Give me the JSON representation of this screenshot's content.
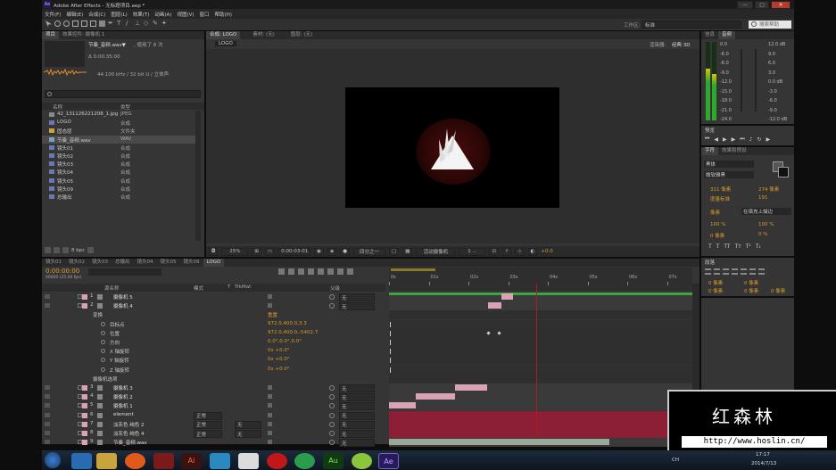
{
  "app": {
    "title": "Adobe After Effects - 无标题项目.aep *"
  },
  "menu": [
    "文件(F)",
    "编辑(E)",
    "合成(C)",
    "图层(L)",
    "效果(T)",
    "动画(A)",
    "视图(V)",
    "窗口",
    "帮助(H)"
  ],
  "toolbar": {
    "workspace_label": "工作区:",
    "workspace_value": "标准",
    "search_placeholder": "搜索帮助"
  },
  "project": {
    "tab_project": "项目",
    "tab_effects": "效果控件: 摄像机 1",
    "selected_name": "节奏_音频.wav▼",
    "used_times": ", 使用了 8 次",
    "duration": "Δ 0:00:35:00",
    "audio_info": "44.100 kHz / 32 bit U / 立体声",
    "col_name": "名称",
    "col_type": "类型",
    "items": [
      {
        "name": "42_131126221208_1.jpg",
        "type": "JPEG"
      },
      {
        "name": "LOGO",
        "type": "合成"
      },
      {
        "name": "固态层",
        "type": "文件夹"
      },
      {
        "name": "节奏_音频.wav",
        "type": "WAV"
      },
      {
        "name": "镜头01",
        "type": "合成"
      },
      {
        "name": "镜头02",
        "type": "合成"
      },
      {
        "name": "镜头03",
        "type": "合成"
      },
      {
        "name": "镜头04",
        "type": "合成"
      },
      {
        "name": "镜头05",
        "type": "合成"
      },
      {
        "name": "镜头09",
        "type": "合成"
      },
      {
        "name": "总输出",
        "type": "合成"
      }
    ],
    "bpc": "8 bpc"
  },
  "viewer": {
    "tab_comp": "合成: LOGO",
    "tab_footage": "素材: (无)",
    "tab_layer": "图层: (无)",
    "comp_chip": "LOGO",
    "renderer_label": "渲染器:",
    "renderer_value": "经典 3D",
    "zoom": "25%",
    "timecode": "0:00:03:01",
    "resolution": "四分之一",
    "view": "活动摄像机",
    "views": "1 ...",
    "exposure": "+0.0"
  },
  "audio": {
    "tab_info": "信息",
    "tab_audio": "音频",
    "left_scale": [
      "0.0",
      "-6.0",
      "-6.0",
      "-9.0",
      "-12.0",
      "-15.0",
      "-18.0",
      "-21.0",
      "-24.0"
    ],
    "right_scale": [
      "12.0 dB",
      "9.0",
      "6.0",
      "3.0",
      "0.0 dB",
      "-3.0",
      "-6.0",
      "-9.0",
      "-12.0 dB"
    ]
  },
  "preview": {
    "title": "预览"
  },
  "character": {
    "tab_char": "字符",
    "tab_effects": "效果和预设",
    "font": "黑体",
    "style": "微软雅黑",
    "size": "311 像素",
    "leading": "274 像素",
    "kerning": "度量标准",
    "tracking": "191",
    "stroke_w": "像素",
    "stroke_type": "在填充上描边",
    "v_scale": "100 %",
    "h_scale": "100 %",
    "baseline": "0 像素",
    "tsume": "0 %"
  },
  "paragraph": {
    "title": "段落",
    "indents": [
      "0 像素",
      "0 像素",
      "0 像素",
      "0 像素",
      "0 像素"
    ]
  },
  "timeline": {
    "tabs": [
      "镜头01",
      "镜头02",
      "镜头03",
      "总输出",
      "镜头04",
      "镜头05",
      "镜头09",
      "LOGO"
    ],
    "timecode": "0:00:00:00",
    "fps": "00000 (25.00 fps)",
    "col_name": "源名称",
    "col_mode": "模式",
    "col_t": "T",
    "col_trkmat": "TrkMat",
    "col_parent": "父级",
    "ruler": [
      "0s",
      "01s",
      "02s",
      "03s",
      "04s",
      "05s",
      "06s",
      "07s"
    ],
    "layers_top": [
      {
        "num": "1",
        "name": "摄像机 5",
        "parent": "无"
      },
      {
        "num": "2",
        "name": "摄像机 4",
        "parent": "无"
      }
    ],
    "transform": {
      "label": "变换",
      "reset": "重置",
      "props": [
        {
          "name": "目标点",
          "value": "972.0,400.0,3.3"
        },
        {
          "name": "位置",
          "value": "972.0,400.0,-5402.7"
        },
        {
          "name": "方向",
          "value": "0.0°,0.0°,0.0°"
        },
        {
          "name": "X 轴旋转",
          "value": "0x +0.0°"
        },
        {
          "name": "Y 轴旋转",
          "value": "0x +0.0°"
        },
        {
          "name": "Z 轴旋转",
          "value": "0x +0.0°"
        }
      ],
      "camera_options": "摄像机选项"
    },
    "layers_bottom": [
      {
        "num": "3",
        "name": "摄像机 3",
        "mode": "",
        "trk": "",
        "parent": "无"
      },
      {
        "num": "4",
        "name": "摄像机 2",
        "mode": "",
        "trk": "",
        "parent": "无"
      },
      {
        "num": "5",
        "name": "摄像机 1",
        "mode": "",
        "trk": "",
        "parent": "无"
      },
      {
        "num": "6",
        "name": "element",
        "mode": "正常",
        "trk": "",
        "parent": "无"
      },
      {
        "num": "7",
        "name": "淡灰色 纯色 2",
        "mode": "正常",
        "trk": "无",
        "parent": "无"
      },
      {
        "num": "8",
        "name": "淡灰色 纯色 4",
        "mode": "正常",
        "trk": "无",
        "parent": "无"
      },
      {
        "num": "9",
        "name": "节奏_音频.wav",
        "mode": "",
        "trk": "",
        "parent": "无"
      }
    ]
  },
  "watermark": {
    "title": "红森林",
    "url": "http://www.hoslin.cn/"
  },
  "taskbar": {
    "time": "17:17",
    "date": "2014/7/13",
    "lang": "CH"
  }
}
